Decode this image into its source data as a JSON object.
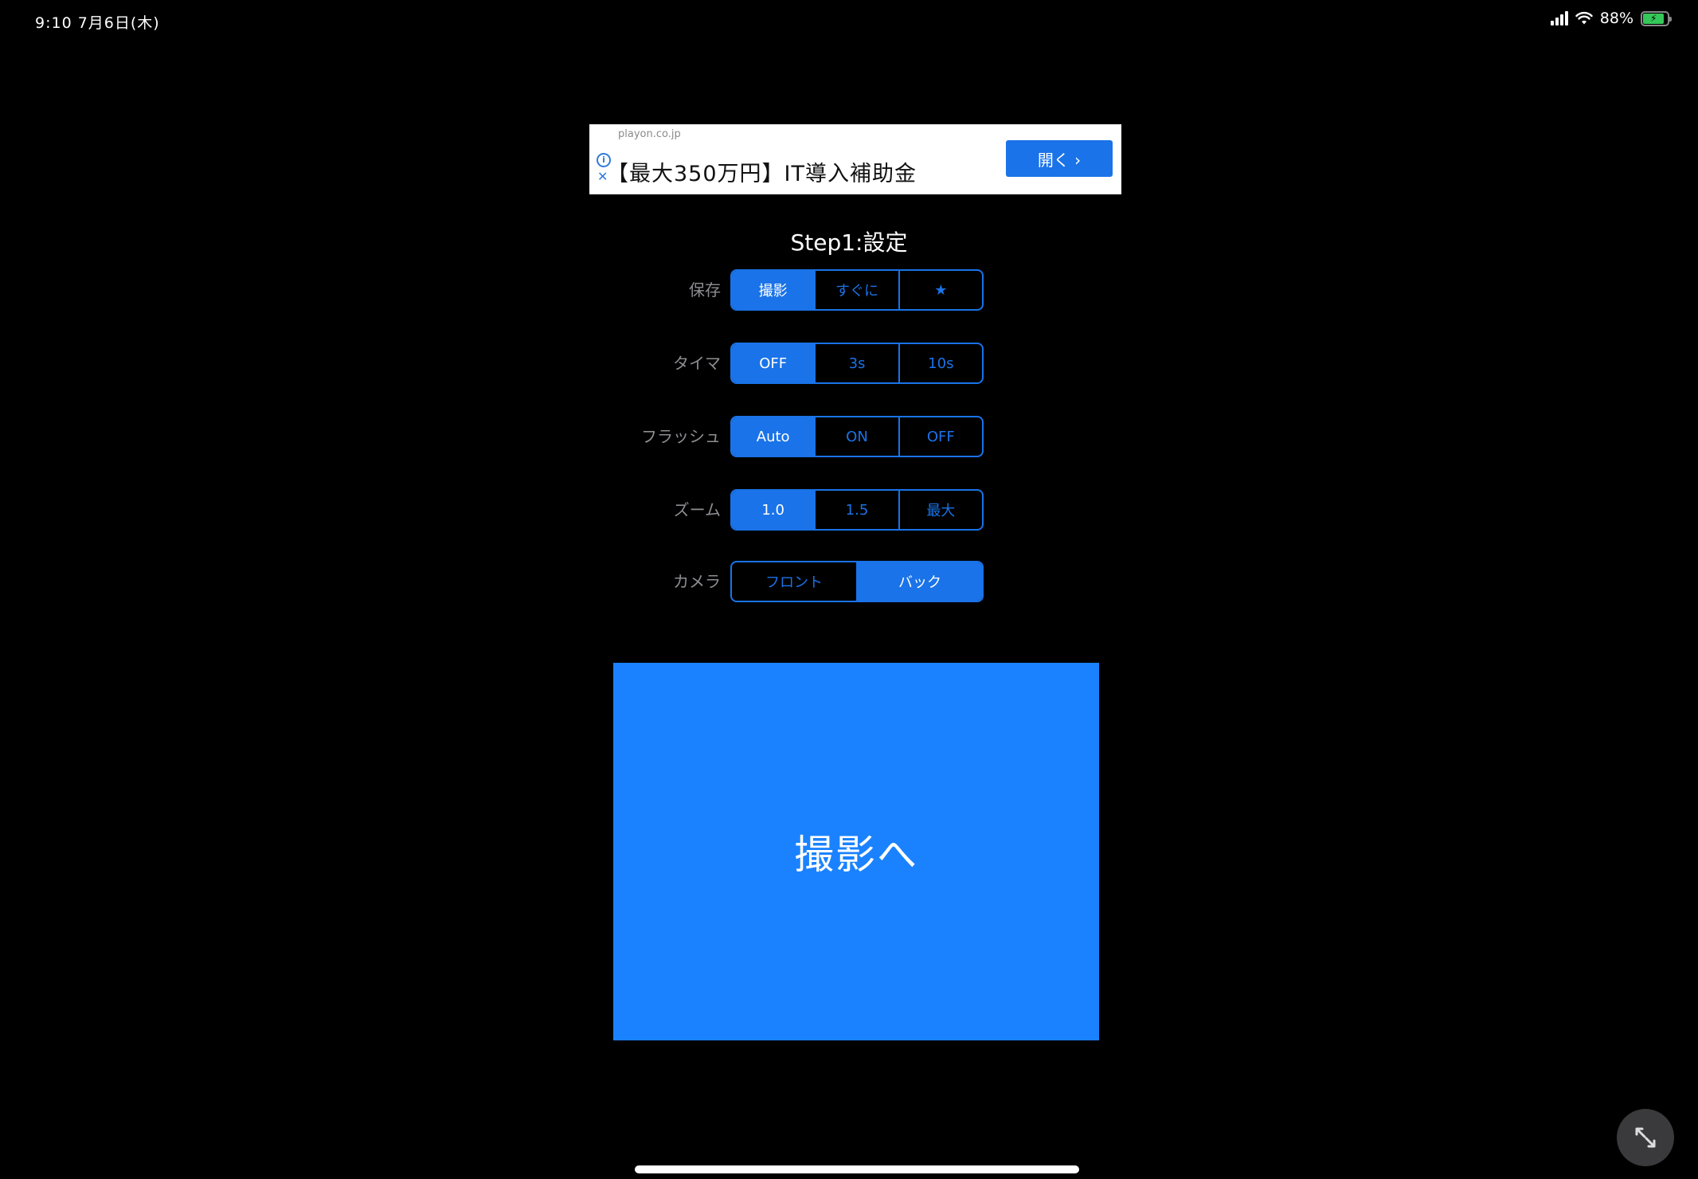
{
  "status_bar": {
    "time": "9:10  7月6日(木)",
    "battery_percent": "88%",
    "battery_level": 0.88
  },
  "ad": {
    "domain": "playon.co.jp",
    "title": "【最大350万円】IT導入補助金",
    "open_label": "開く ›",
    "info_icon": "info-icon",
    "close_icon": "close-icon"
  },
  "settings": {
    "title": "Step1:設定",
    "rows": [
      {
        "label": "保存",
        "options": [
          "撮影",
          "すぐに",
          "★"
        ],
        "selected": 0
      },
      {
        "label": "タイマ",
        "options": [
          "OFF",
          "3s",
          "10s"
        ],
        "selected": 0
      },
      {
        "label": "フラッシュ",
        "options": [
          "Auto",
          "ON",
          "OFF"
        ],
        "selected": 0
      },
      {
        "label": "ズーム",
        "options": [
          "1.0",
          "1.5",
          "最大"
        ],
        "selected": 0
      },
      {
        "label": "カメラ",
        "options": [
          "フロント",
          "バック"
        ],
        "selected": 1
      }
    ]
  },
  "capture_button_label": "撮影へ",
  "colors": {
    "accent": "#1a73e8",
    "button": "#1a82ff",
    "background": "#000000"
  }
}
